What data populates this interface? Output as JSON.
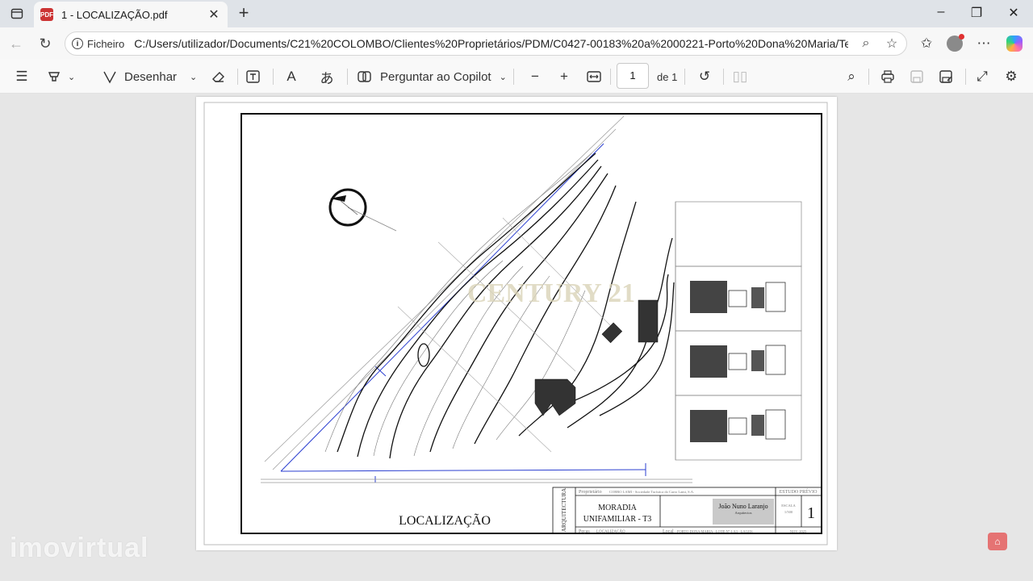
{
  "browser": {
    "tab_title": "1 - LOCALIZAÇÃO.pdf",
    "address_label": "Ficheiro",
    "url": "C:/Users/utilizador/Documents/C21%20COLOMBO/Clientes%20Proprietários/PDM/C0427-00183%20a%2000221-Porto%20Dona%20Maria/Ter..."
  },
  "pdf_toolbar": {
    "draw_label": "Desenhar",
    "copilot_label": "Perguntar ao Copilot",
    "page_current": "1",
    "page_of": "de 1"
  },
  "drawing": {
    "title": "LOCALIZAÇÃO",
    "watermark": "CENTURY 21",
    "titleblock": {
      "discipline": "ARQUITECTURA",
      "owner_label": "Proprietário",
      "owner_value": "COBRO LAMI - Sociedade Turística do Carro Lami, S.A.",
      "project_name_1": "MORADIA",
      "project_name_2": "UNIFAMILIAR - T3",
      "architect_name": "João Nuno Laranjo",
      "architect_role": "Arquitectos",
      "phase": "ESTUDO PRÉVIO",
      "scale_label": "ESCALA",
      "scale_value": "1/500",
      "sheet_number": "1",
      "peca_label": "Peças",
      "peca_value": "LOCALIZAÇÃO",
      "local_label": "Local",
      "local_value": "PORTO DONA MARIA - LOTE Nº 1 A3 - LAGOS",
      "date_value": "NOV. 2025"
    }
  },
  "overlay": {
    "site_watermark": "imovirtual"
  }
}
